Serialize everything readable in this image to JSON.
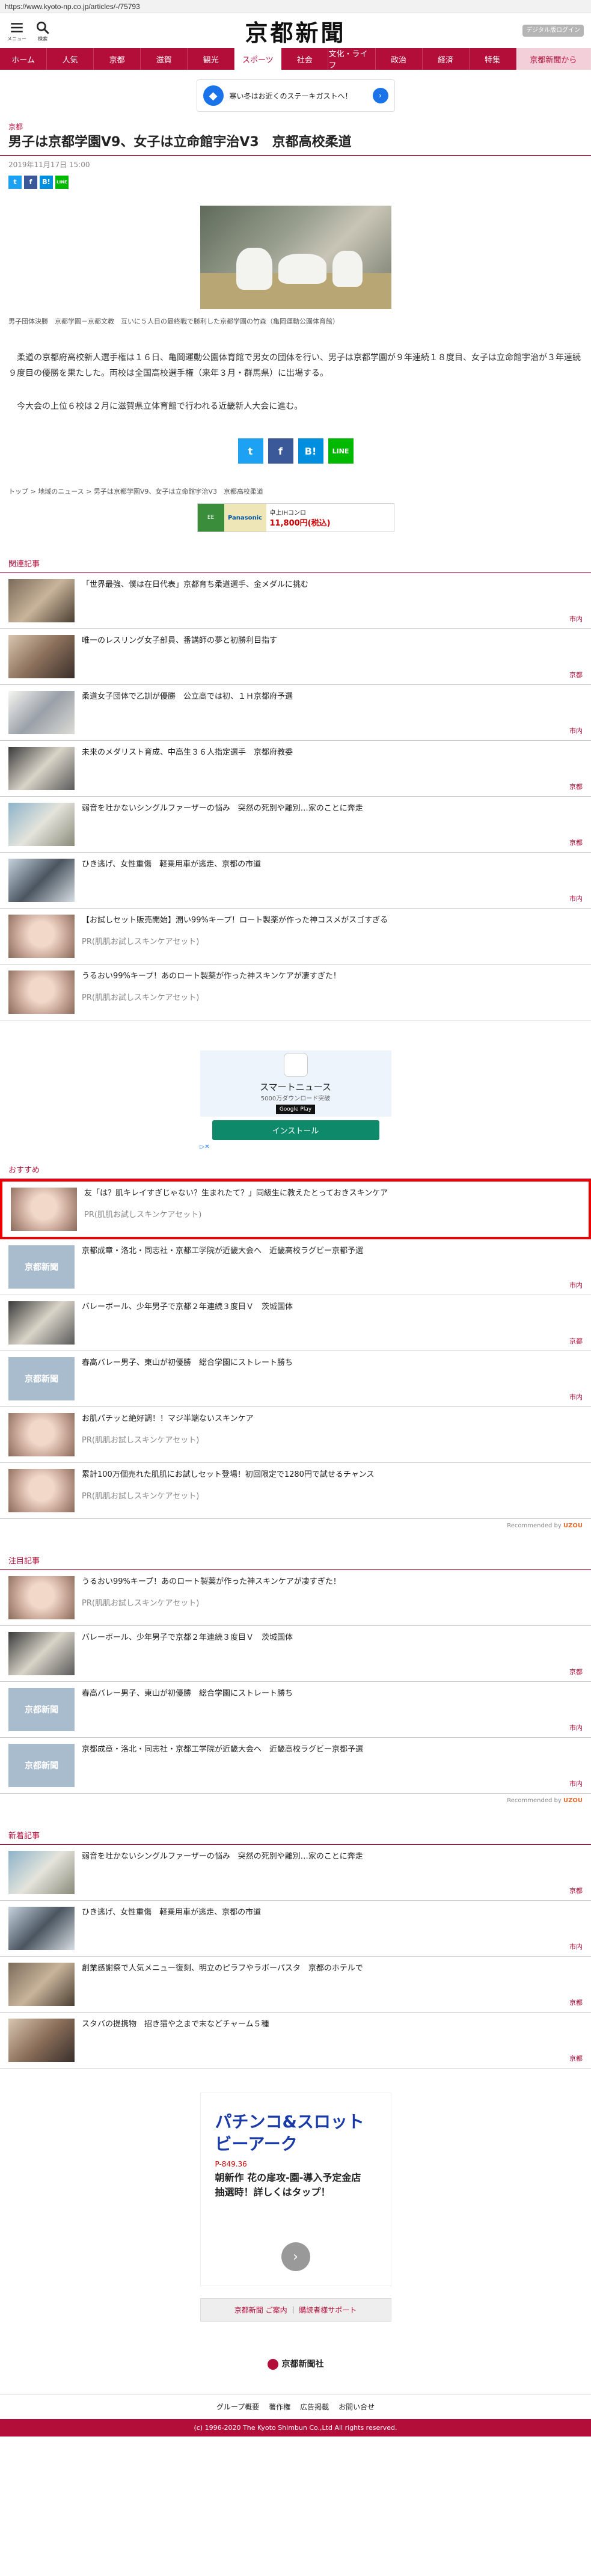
{
  "browser": {
    "url": "https://www.kyoto-np.co.jp/articles/-/75793"
  },
  "header": {
    "menu_label": "メニュー",
    "search_label": "検索",
    "logo": "京都新聞",
    "digital_btn": "デジタル版ログイン"
  },
  "nav": {
    "items": [
      "ホーム",
      "人気",
      "京都",
      "滋賀",
      "観光",
      "スポーツ",
      "社会",
      "文化・ライフ",
      "政治",
      "経済",
      "特集",
      "京都新聞から"
    ]
  },
  "top_ad": {
    "text": "寒い冬はお近くのステーキガストへ！"
  },
  "article": {
    "section": "京都",
    "title": "男子は京都学園V9、女子は立命館宇治V3　京都高校柔道",
    "date": "2019年11月17日 15:00",
    "caption": "男子団体決勝　京都学園－京都文教　互いに５人目の最終戦で勝利した京都学園の竹森（亀岡運動公園体育館）",
    "paragraphs": [
      "柔道の京都府高校新人選手権は１６日、亀岡運動公園体育館で男女の団体を行い、男子は京都学園が９年連続１８度目、女子は立命館宇治が３年連続９度目の優勝を果たした。両校は全国高校選手権（来年３月・群馬県）に出場する。",
      "今大会の上位６校は２月に滋賀県立体育館で行われる近畿新人大会に進む。"
    ],
    "breadcrumb": [
      "トップ",
      "地域のニュース",
      "男子は京都学園V9、女子は立命館宇治V3　京都高校柔道"
    ]
  },
  "share": {
    "twitter": "t",
    "facebook": "f",
    "hatena": "B!",
    "line": "LINE"
  },
  "banner_ad": {
    "left": "EE",
    "brand": "Panasonic",
    "product": "卓上IHコンロ",
    "price": "11,800円(税込)"
  },
  "related": {
    "heading": "関連記事",
    "items": [
      {
        "title": "「世界最強、僕は在日代表」京都育ち柔道選手、金メダルに挑む",
        "category": "市内",
        "thumb": "photo1",
        "pr": ""
      },
      {
        "title": "唯一のレスリング女子部員、番講師の夢と初勝利目指す",
        "category": "京都",
        "thumb": "photo2",
        "pr": ""
      },
      {
        "title": "柔道女子団体で乙訓が優勝　公立高では初、１Ｈ京都府予選",
        "category": "市内",
        "thumb": "photo3",
        "pr": ""
      },
      {
        "title": "未来のメダリスト育成、中高生３６人指定選手　京都府教委",
        "category": "京都",
        "thumb": "photo4",
        "pr": ""
      },
      {
        "title": "弱音を吐かないシングルファーザーの悩み　突然の死別や離別…家のことに奔走",
        "category": "京都",
        "thumb": "photo5",
        "pr": ""
      },
      {
        "title": "ひき逃げ、女性重傷　軽乗用車が逃走、京都の市道",
        "category": "市内",
        "thumb": "photo6",
        "pr": ""
      },
      {
        "title": "【お試しセット販売開始】潤い99%キープ！ロート製薬が作った神コスメがスゴすぎる",
        "category": "",
        "thumb": "face",
        "pr": "PR(肌肌お試しスキンケアセット)"
      },
      {
        "title": "うるおい99%キープ！あのロート製薬が作った神スキンケアが凄すぎた！",
        "category": "",
        "thumb": "face",
        "pr": "PR(肌肌お試しスキンケアセット)"
      }
    ]
  },
  "app_ad": {
    "name": "スマートニュース",
    "sub": "5000万ダウンロード突破",
    "store": "Google Play",
    "install": "インストール"
  },
  "recommend": {
    "heading": "おすすめ",
    "items": [
      {
        "title": "友「は？肌キレイすぎじゃない？生まれたて？」同級生に教えたとっておきスキンケア",
        "category": "",
        "thumb": "face",
        "pr": "PR(肌肌お試しスキンケアセット)",
        "highlight": true
      },
      {
        "title": "京都成章・洛北・同志社・京都工学院が近畿大会へ　近畿高校ラグビー京都予選",
        "category": "市内",
        "thumb": "np",
        "pr": ""
      },
      {
        "title": "バレーボール、少年男子で京都２年連続３度目Ｖ　茨城国体",
        "category": "京都",
        "thumb": "photo4",
        "pr": ""
      },
      {
        "title": "春高バレー男子、東山が初優勝　総合学園にストレート勝ち",
        "category": "市内",
        "thumb": "np",
        "pr": ""
      },
      {
        "title": "お肌パチッと絶好調！！マジ半端ないスキンケア",
        "category": "",
        "thumb": "face",
        "pr": "PR(肌肌お試しスキンケアセット)"
      },
      {
        "title": "累計100万個売れた肌肌にお試しセット登場！初回限定で1280円で試せるチャンス",
        "category": "",
        "thumb": "face",
        "pr": "PR(肌肌お試しスキンケアセット)"
      }
    ],
    "recommended_by": "Recommended by",
    "brand": "UZOU"
  },
  "attention": {
    "heading": "注目記事",
    "items": [
      {
        "title": "うるおい99%キープ！あのロート製薬が作った神スキンケアが凄すぎた！",
        "category": "",
        "thumb": "face",
        "pr": "PR(肌肌お試しスキンケアセット)"
      },
      {
        "title": "バレーボール、少年男子で京都２年連続３度目Ｖ　茨城国体",
        "category": "京都",
        "thumb": "photo4",
        "pr": ""
      },
      {
        "title": "春高バレー男子、東山が初優勝　総合学園にストレート勝ち",
        "category": "市内",
        "thumb": "np",
        "pr": ""
      },
      {
        "title": "京都成章・洛北・同志社・京都工学院が近畿大会へ　近畿高校ラグビー京都予選",
        "category": "市内",
        "thumb": "np",
        "pr": ""
      }
    ],
    "recommended_by": "Recommended by",
    "brand": "UZOU"
  },
  "latest": {
    "heading": "新着記事",
    "items": [
      {
        "title": "弱音を吐かないシングルファーザーの悩み　突然の死別や離別…家のことに奔走",
        "category": "京都",
        "thumb": "photo5",
        "pr": ""
      },
      {
        "title": "ひき逃げ、女性重傷　軽乗用車が逃走、京都の市道",
        "category": "市内",
        "thumb": "photo6",
        "pr": ""
      },
      {
        "title": "創業感謝祭で人気メニュー復刻、明立のピラフやラボーパスタ　京都のホテルで",
        "category": "京都",
        "thumb": "photo1",
        "pr": ""
      },
      {
        "title": "スタバの提携物　招き猫や之まで末などチャーム５種",
        "category": "京都",
        "thumb": "photo2",
        "pr": ""
      }
    ]
  },
  "bottom_ad": {
    "title": "パチンコ&スロット ビーアーク",
    "sub": "P-849.36",
    "body": "朝新作 花の扉攻-園-導入予定金店　抽選時！詳しくはタップ！",
    "arrow": "›"
  },
  "footer": {
    "links": [
      "京都新聞 ご案内",
      "購読者様サポート"
    ],
    "company": "京都新聞社",
    "nav": [
      "グループ概要",
      "著作権",
      "広告掲載",
      "お問い合せ"
    ],
    "copyright": "(c) 1996-2020 The Kyoto Shimbun Co.,Ltd All rights reserved."
  }
}
